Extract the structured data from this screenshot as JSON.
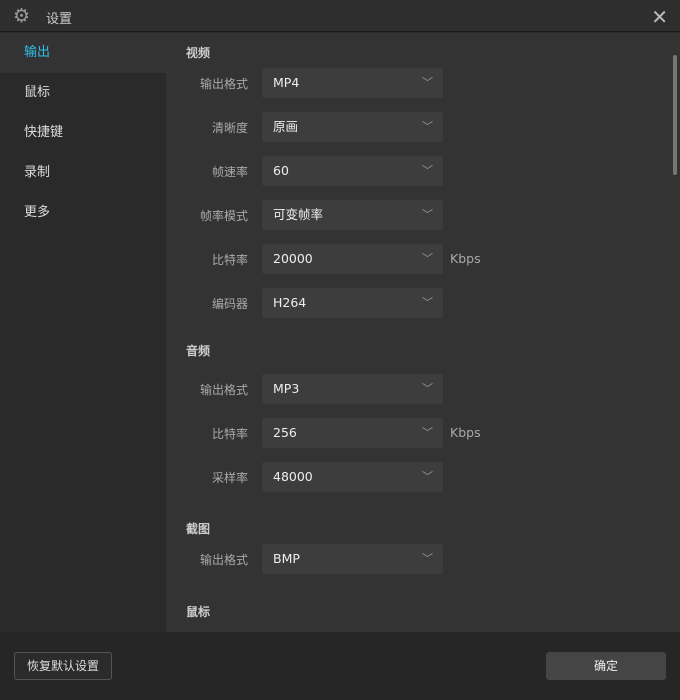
{
  "window": {
    "title": "设置",
    "close": "✕",
    "gear": "⚙"
  },
  "sidebar": {
    "items": [
      {
        "label": "输出"
      },
      {
        "label": "鼠标"
      },
      {
        "label": "快捷键"
      },
      {
        "label": "录制"
      },
      {
        "label": "更多"
      }
    ]
  },
  "video": {
    "title": "视频",
    "fields": [
      {
        "label": "输出格式",
        "value": "MP4"
      },
      {
        "label": "清晰度",
        "value": "原画"
      },
      {
        "label": "帧速率",
        "value": "60"
      },
      {
        "label": "帧率模式",
        "value": "可变帧率"
      },
      {
        "label": "比特率",
        "value": "20000",
        "unit": "Kbps"
      },
      {
        "label": "编码器",
        "value": "H264"
      }
    ]
  },
  "audio": {
    "title": "音频",
    "fields": [
      {
        "label": "输出格式",
        "value": "MP3"
      },
      {
        "label": "比特率",
        "value": "256",
        "unit": "Kbps"
      },
      {
        "label": "采样率",
        "value": "48000"
      }
    ]
  },
  "screenshot": {
    "title": "截图",
    "fields": [
      {
        "label": "输出格式",
        "value": "BMP"
      }
    ]
  },
  "mouse": {
    "title": "鼠标"
  },
  "footer": {
    "reset": "恢复默认设置",
    "ok": "确定"
  },
  "chevron": "﹀"
}
